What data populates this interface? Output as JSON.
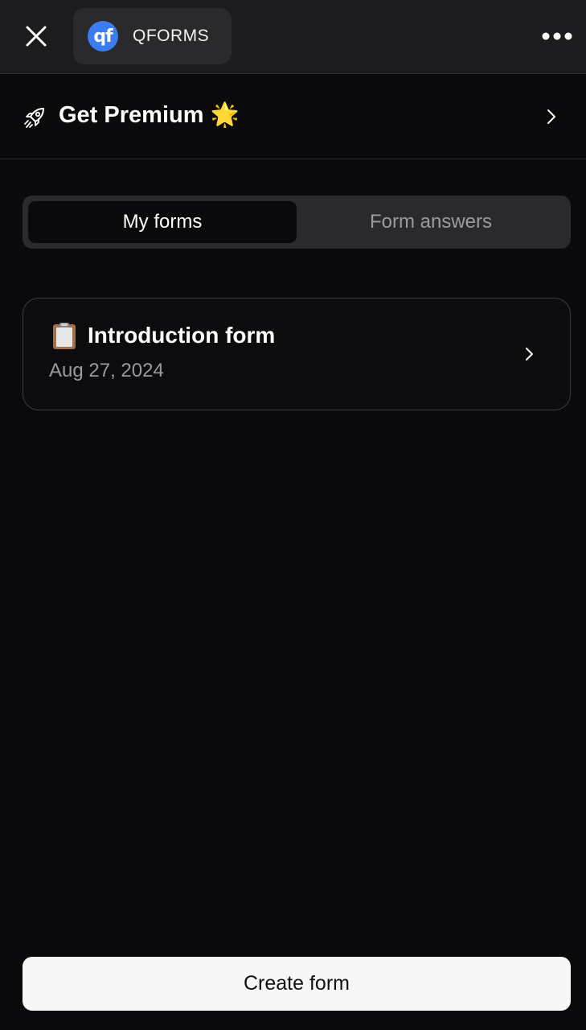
{
  "header": {
    "close_icon": "close-icon",
    "app_logo_text": "qf",
    "app_name": "QFORMS",
    "more_icon": "more-horizontal-icon",
    "logo_color": "#3b7cf0"
  },
  "premium": {
    "label": "Get Premium 🌟",
    "icon": "rocket-icon",
    "chevron_icon": "chevron-right-icon"
  },
  "tabs": [
    {
      "label": "My forms",
      "active": true
    },
    {
      "label": "Form answers",
      "active": false
    }
  ],
  "forms": [
    {
      "emoji_icon": "clipboard-icon",
      "title": "Introduction form",
      "date": "Aug 27, 2024"
    }
  ],
  "footer": {
    "create_label": "Create form"
  }
}
